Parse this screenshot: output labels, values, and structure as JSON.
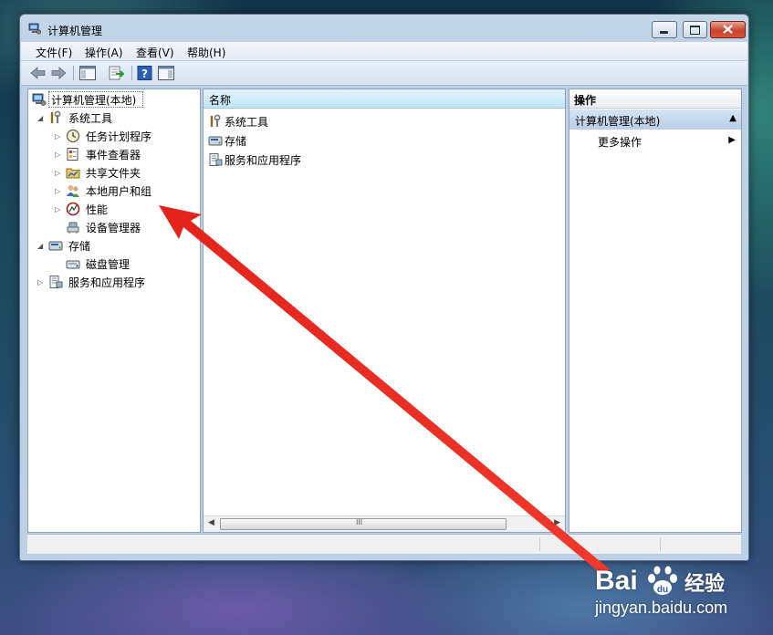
{
  "window": {
    "title": "计算机管理"
  },
  "menu": [
    {
      "label": "文件(F)"
    },
    {
      "label": "操作(A)"
    },
    {
      "label": "查看(V)"
    },
    {
      "label": "帮助(H)"
    }
  ],
  "toolbar": {
    "icons": [
      "back-arrow-icon",
      "forward-arrow-icon",
      "show-hide-console-tree-icon",
      "export-list-icon",
      "help-icon",
      "show-hide-action-pane-icon"
    ]
  },
  "tree": {
    "root": "计算机管理(本地)",
    "system_tools": "系统工具",
    "task_scheduler": "任务计划程序",
    "event_viewer": "事件查看器",
    "shared_folders": "共享文件夹",
    "local_users_groups": "本地用户和组",
    "performance": "性能",
    "device_manager": "设备管理器",
    "storage": "存储",
    "disk_management": "磁盘管理",
    "services_apps": "服务和应用程序"
  },
  "list": {
    "column_name": "名称",
    "items": [
      "系统工具",
      "存储",
      "服务和应用程序"
    ],
    "scroll_grip": "III"
  },
  "actions": {
    "header": "操作",
    "section": "计算机管理(本地)",
    "more": "更多操作"
  },
  "watermark": {
    "brand": "Bai",
    "cn": "经验",
    "url": "jingyan.baidu.com"
  },
  "colors": {
    "annotation_arrow": "#e8261c",
    "selection_header": "#bfe6f6"
  }
}
